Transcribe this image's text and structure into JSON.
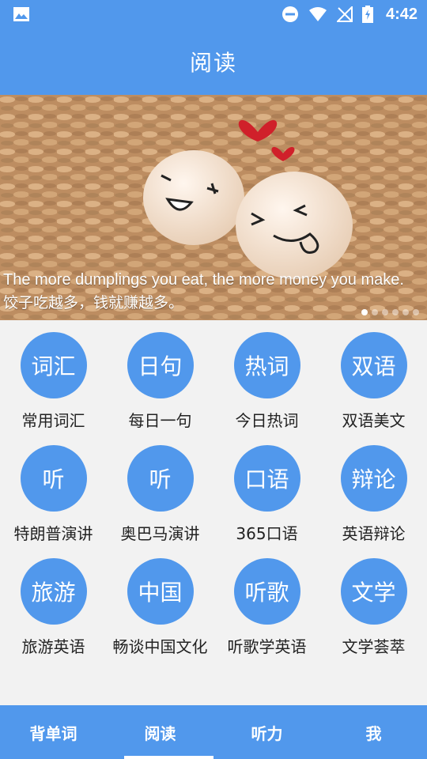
{
  "status": {
    "time": "4:42"
  },
  "header": {
    "title": "阅读"
  },
  "banner": {
    "caption_en": "The more dumplings you eat, the more money you make.",
    "caption_zh": "饺子吃越多，钱就赚越多。",
    "slide_count": 6,
    "active_slide": 1
  },
  "grid": [
    {
      "icon_text": "词汇",
      "label": "常用词汇"
    },
    {
      "icon_text": "日句",
      "label": "每日一句"
    },
    {
      "icon_text": "热词",
      "label": "今日热词"
    },
    {
      "icon_text": "双语",
      "label": "双语美文"
    },
    {
      "icon_text": "听",
      "label": "特朗普演讲"
    },
    {
      "icon_text": "听",
      "label": "奥巴马演讲"
    },
    {
      "icon_text": "口语",
      "label": "365口语"
    },
    {
      "icon_text": "辩论",
      "label": "英语辩论"
    },
    {
      "icon_text": "旅游",
      "label": "旅游英语"
    },
    {
      "icon_text": "中国",
      "label": "畅谈中国文化"
    },
    {
      "icon_text": "听歌",
      "label": "听歌学英语"
    },
    {
      "icon_text": "文学",
      "label": "文学荟萃"
    }
  ],
  "nav": [
    "背单词",
    "阅读",
    "听力",
    "我"
  ],
  "nav_active": 1,
  "colors": {
    "primary": "#5198ec",
    "background": "#f2f2f2"
  }
}
